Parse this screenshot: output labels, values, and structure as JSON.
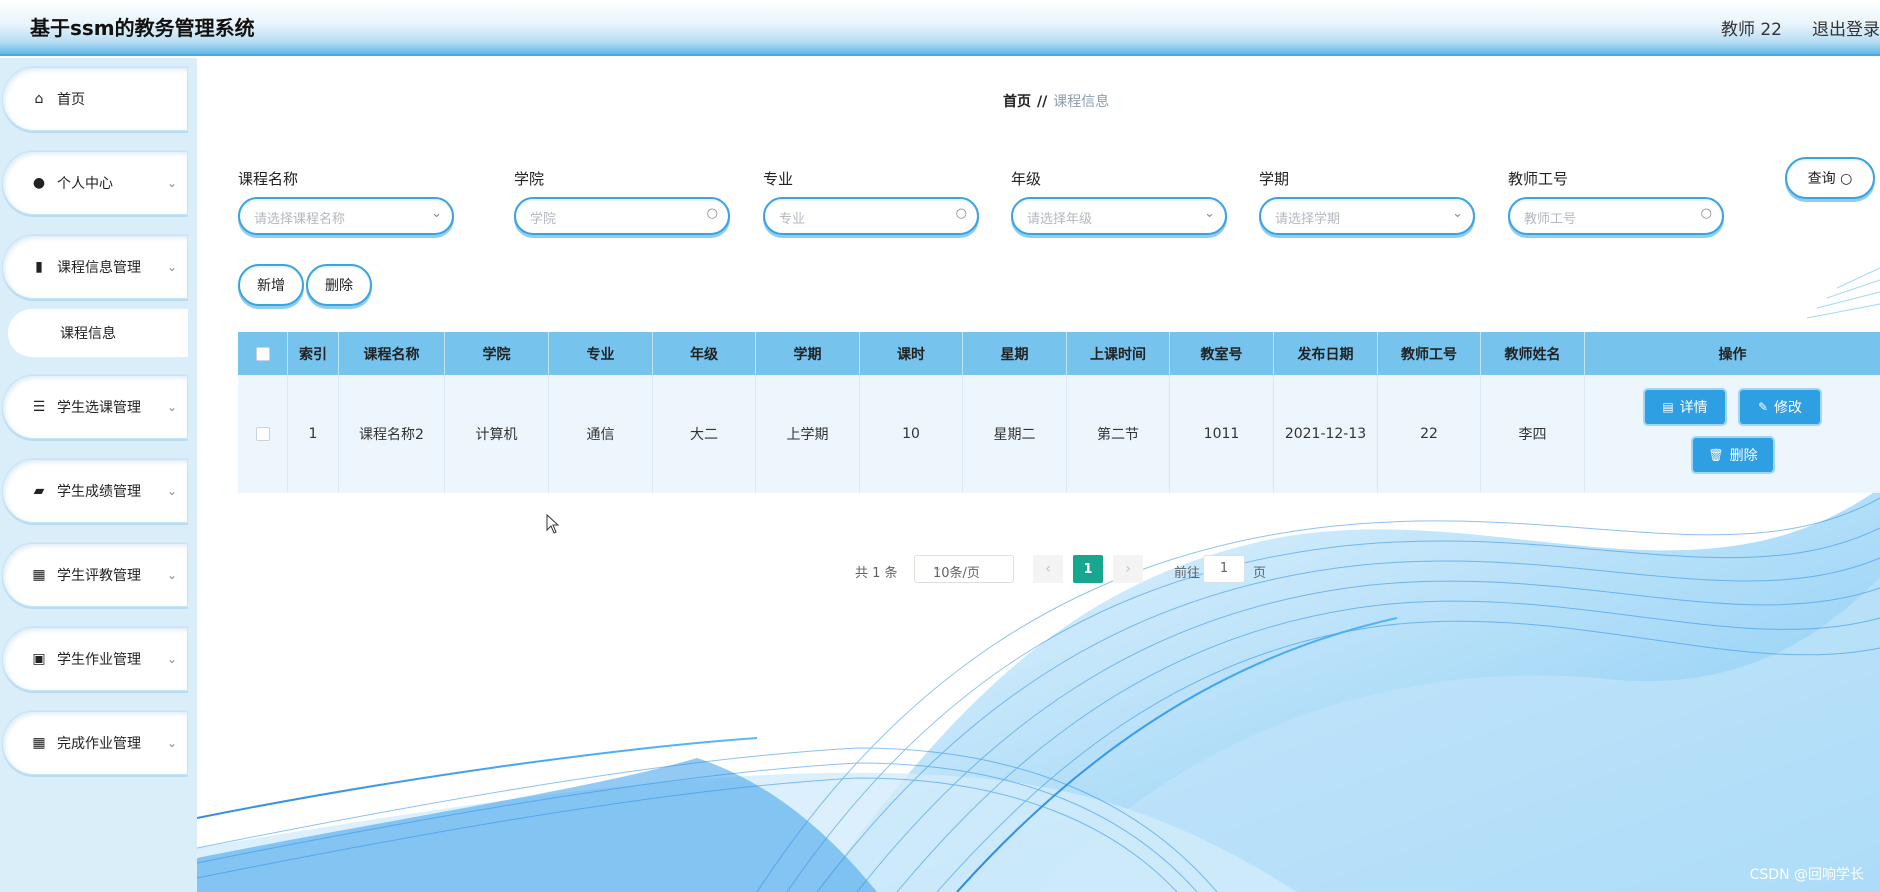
{
  "header": {
    "title": "基于ssm的教务管理系统",
    "user": "教师 22",
    "logout": "退出登录"
  },
  "sidebar": {
    "items": [
      {
        "label": "首页",
        "icon": "home-icon",
        "glyph": "⌂",
        "has_chevron": false
      },
      {
        "label": "个人中心",
        "icon": "user-icon",
        "glyph": "●",
        "has_chevron": true
      },
      {
        "label": "课程信息管理",
        "icon": "book-icon",
        "glyph": "▮",
        "has_chevron": true
      },
      {
        "label": "学生选课管理",
        "icon": "list-icon",
        "glyph": "☰",
        "has_chevron": true
      },
      {
        "label": "学生成绩管理",
        "icon": "briefcase-icon",
        "glyph": "▰",
        "has_chevron": true
      },
      {
        "label": "学生评教管理",
        "icon": "grid-icon",
        "glyph": "▦",
        "has_chevron": true
      },
      {
        "label": "学生作业管理",
        "icon": "clipboard-icon",
        "glyph": "▣",
        "has_chevron": true
      },
      {
        "label": "完成作业管理",
        "icon": "grid-icon",
        "glyph": "▦",
        "has_chevron": true
      }
    ],
    "submenu": {
      "label": "课程信息"
    }
  },
  "breadcrumb": {
    "home": "首页",
    "separator": "//",
    "current": "课程信息"
  },
  "filters": [
    {
      "label": "课程名称",
      "placeholder": "请选择课程名称",
      "icon": "chevron-down-icon",
      "glyph": "⌄"
    },
    {
      "label": "学院",
      "placeholder": "学院",
      "icon": "search-icon",
      "glyph": "○"
    },
    {
      "label": "专业",
      "placeholder": "专业",
      "icon": "search-icon",
      "glyph": "○"
    },
    {
      "label": "年级",
      "placeholder": "请选择年级",
      "icon": "chevron-down-icon",
      "glyph": "⌄"
    },
    {
      "label": "学期",
      "placeholder": "请选择学期",
      "icon": "chevron-down-icon",
      "glyph": "⌄"
    },
    {
      "label": "教师工号",
      "placeholder": "教师工号",
      "icon": "search-icon",
      "glyph": "○"
    }
  ],
  "buttons": {
    "search": "查询 ○",
    "add": "新增",
    "delete": "删除"
  },
  "table": {
    "columns": [
      "索引",
      "课程名称",
      "学院",
      "专业",
      "年级",
      "学期",
      "课时",
      "星期",
      "上课时间",
      "教室号",
      "发布日期",
      "教师工号",
      "教师姓名",
      "操作"
    ],
    "rows": [
      {
        "cells": [
          "1",
          "课程名称2",
          "计算机",
          "通信",
          "大二",
          "上学期",
          "10",
          "星期二",
          "第二节",
          "1011",
          "2021-12-13",
          "22",
          "李四"
        ]
      }
    ],
    "actions": {
      "detail": "详情",
      "edit": "修改",
      "delete": "删除"
    }
  },
  "pagination": {
    "total": "共 1 条",
    "page_size": "10条/页",
    "prev": "‹",
    "current_page": "1",
    "next": "›",
    "goto_label": "前往",
    "goto_value": "1",
    "goto_suffix": "页"
  },
  "watermark": "CSDN @回响学长",
  "colors": {
    "accent": "#2f9fe3",
    "header_row": "#76c3ee",
    "pager_active": "#17a78f",
    "sidebar_bg": "#d9eef9"
  }
}
